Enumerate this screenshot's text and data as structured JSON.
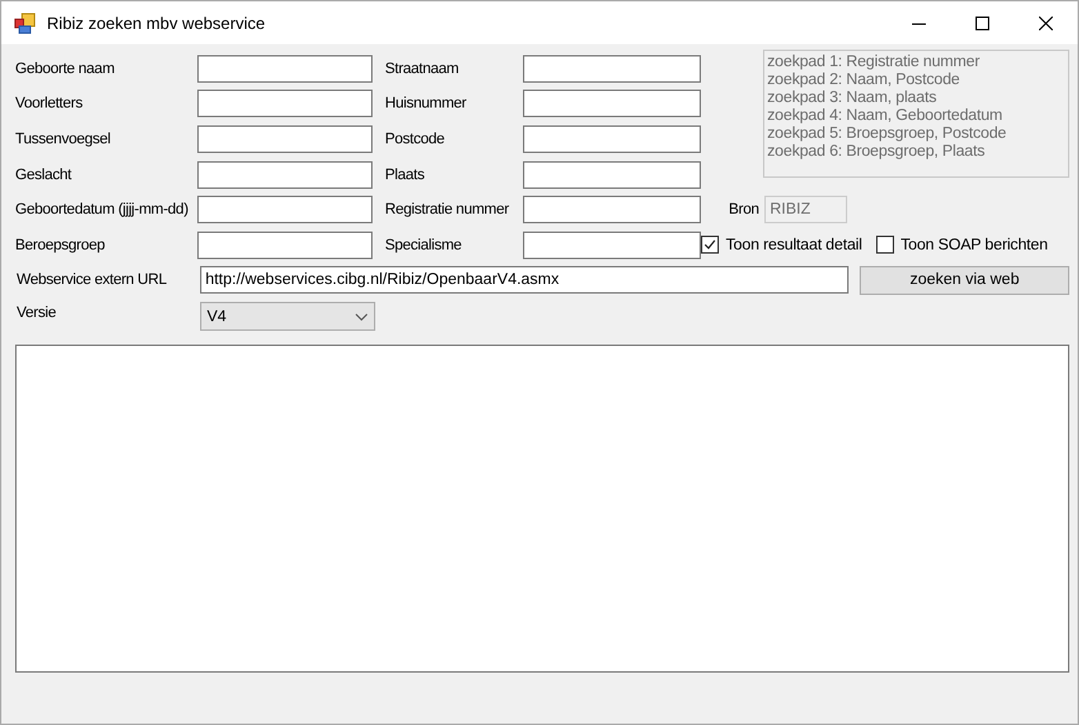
{
  "window": {
    "title": "Ribiz zoeken mbv webservice"
  },
  "left_fields": [
    {
      "label": "Geboorte naam"
    },
    {
      "label": "Voorletters"
    },
    {
      "label": "Tussenvoegsel"
    },
    {
      "label": "Geslacht"
    },
    {
      "label": "Geboortedatum (jjjj-mm-dd)"
    },
    {
      "label": "Beroepsgroep"
    }
  ],
  "right_fields": [
    {
      "label": "Straatnaam"
    },
    {
      "label": "Huisnummer"
    },
    {
      "label": "Postcode"
    },
    {
      "label": "Plaats"
    },
    {
      "label": "Registratie nummer"
    },
    {
      "label": "Specialisme"
    }
  ],
  "search_paths": [
    "zoekpad 1: Registratie nummer",
    "zoekpad 2: Naam, Postcode",
    "zoekpad 3: Naam, plaats",
    "zoekpad 4: Naam, Geboortedatum",
    "zoekpad 5: Broepsgroep, Postcode",
    "zoekpad 6: Broepsgroep, Plaats"
  ],
  "source": {
    "label": "Bron",
    "value": "RIBIZ"
  },
  "checkboxes": [
    {
      "label": "Toon resultaat detail",
      "checked": true
    },
    {
      "label": "Toon SOAP berichten",
      "checked": false
    }
  ],
  "url": {
    "label": "Webservice extern URL",
    "value": "http://webservices.cibg.nl/Ribiz/OpenbaarV4.asmx"
  },
  "search_button": "zoeken via web",
  "version": {
    "label": "Versie",
    "value": "V4"
  }
}
